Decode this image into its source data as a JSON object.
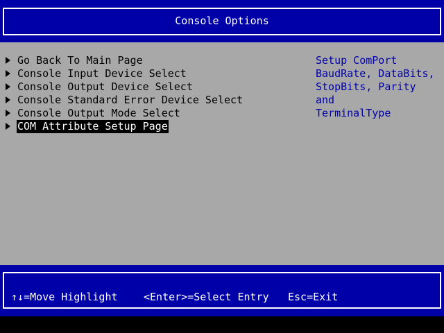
{
  "header": {
    "title": "Console Options"
  },
  "menu": {
    "items": [
      {
        "label": "Go Back To Main Page"
      },
      {
        "label": "Console Input Device Select"
      },
      {
        "label": "Console Output Device Select"
      },
      {
        "label": "Console Standard Error Device Select"
      },
      {
        "label": "Console Output Mode Select"
      },
      {
        "label": "COM Attribute Setup Page",
        "selected": true
      }
    ]
  },
  "help": {
    "text": "Setup ComPort\nBaudRate, DataBits,\nStopBits, Parity and\nTerminalType"
  },
  "footer": {
    "move": "↑↓=Move Highlight",
    "select": "<Enter>=Select Entry",
    "exit": "Esc=Exit"
  },
  "colors": {
    "background": "#a8a8a8",
    "band": "#0000a8",
    "text": "#000000",
    "help_text": "#0000a8",
    "highlight_bg": "#000000",
    "highlight_text": "#ffffff"
  }
}
